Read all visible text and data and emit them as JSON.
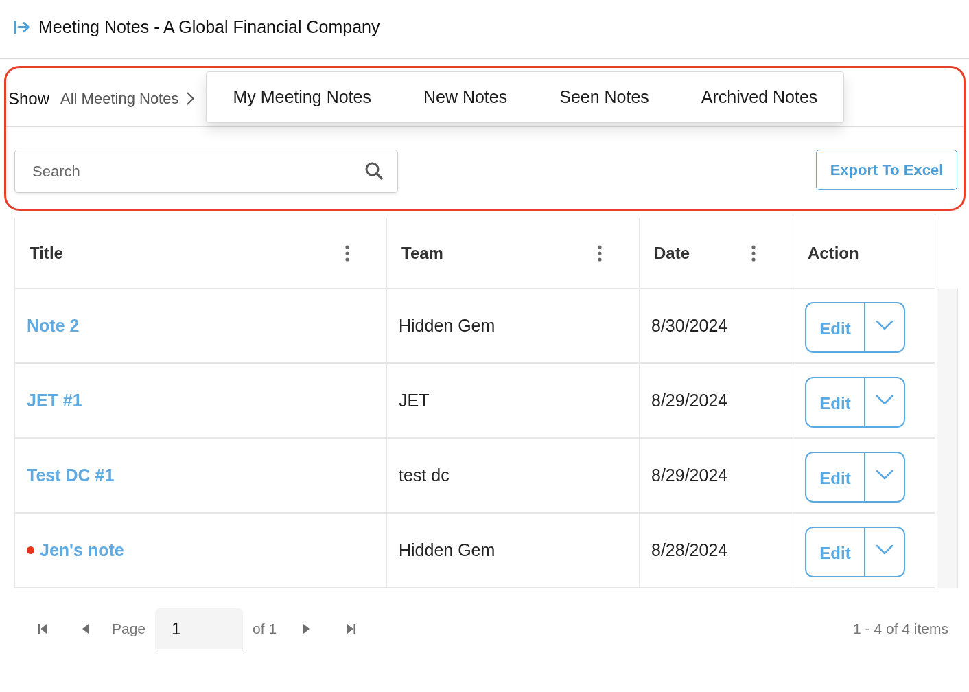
{
  "header": {
    "title": "Meeting Notes - A Global Financial Company"
  },
  "toolbar": {
    "highlighted": true,
    "show_label": "Show",
    "current_view": "All Meeting Notes",
    "view_menu": [
      {
        "label": "My Meeting Notes"
      },
      {
        "label": "New Notes"
      },
      {
        "label": "Seen Notes"
      },
      {
        "label": "Archived Notes"
      }
    ],
    "search": {
      "placeholder": "Search"
    },
    "export_button": "Export To Excel"
  },
  "table": {
    "columns": [
      {
        "label": "Title",
        "has_menu": true
      },
      {
        "label": "Team",
        "has_menu": true
      },
      {
        "label": "Date",
        "has_menu": true
      },
      {
        "label": "Action",
        "has_menu": false
      }
    ],
    "rows": [
      {
        "title": "Note 2",
        "unread": false,
        "team": "Hidden Gem",
        "date": "8/30/2024",
        "action": "Edit"
      },
      {
        "title": "JET #1",
        "unread": false,
        "team": "JET",
        "date": "8/29/2024",
        "action": "Edit"
      },
      {
        "title": "Test DC #1",
        "unread": false,
        "team": "test dc",
        "date": "8/29/2024",
        "action": "Edit"
      },
      {
        "title": "Jen's note",
        "unread": true,
        "team": "Hidden Gem",
        "date": "8/28/2024",
        "action": "Edit"
      }
    ]
  },
  "pagination": {
    "page_label": "Page",
    "page": "1",
    "page_count": "of 1",
    "summary": "1 - 4 of 4 items"
  }
}
